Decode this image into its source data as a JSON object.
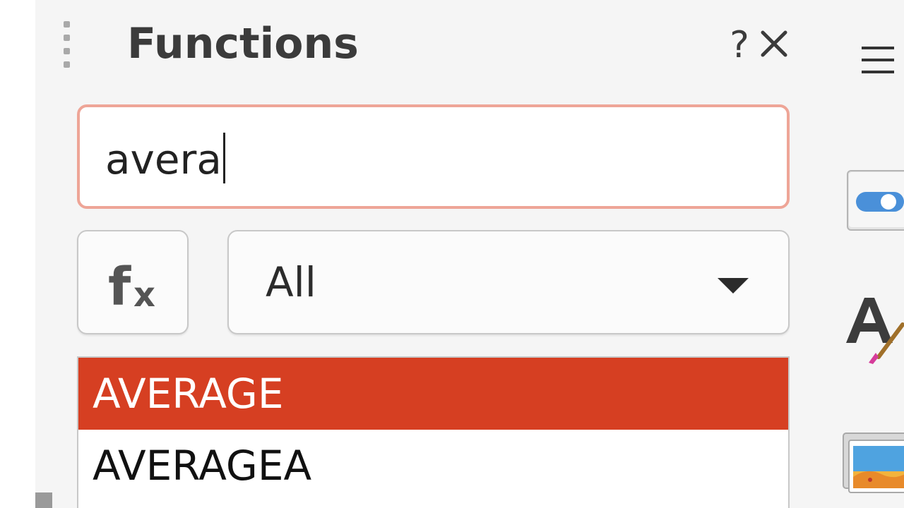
{
  "panel": {
    "title": "Functions",
    "help_label": "?",
    "close_icon": "close-icon",
    "grip_icon": "drag-handle-icon"
  },
  "search": {
    "value": "avera"
  },
  "insert_function": {
    "icon": "fx-icon",
    "label": "fx"
  },
  "category": {
    "selected": "All"
  },
  "functions_list": {
    "items": [
      "AVERAGE",
      "AVERAGEA"
    ],
    "selected_index": 0
  },
  "sidebar": {
    "menu_icon": "hamburger-menu-icon",
    "buttons": [
      "properties-toggle-icon",
      "styles-icon",
      "gallery-icon"
    ]
  },
  "colors": {
    "panel_bg": "#f5f5f5",
    "search_border": "#eea597",
    "selection": "#d63f22",
    "text": "#3b3b3b"
  }
}
